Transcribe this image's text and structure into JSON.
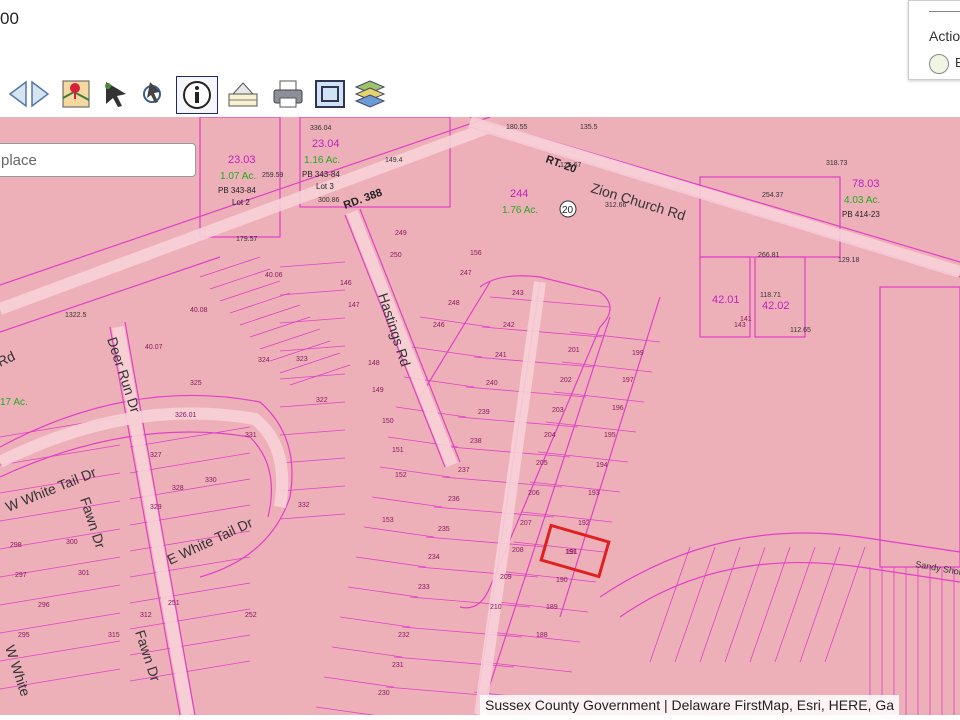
{
  "topbar": {
    "value": "00"
  },
  "actions_panel": {
    "title": "Actio",
    "item_label": "E"
  },
  "toolbar": {
    "tools": [
      "back-arrow",
      "forward-arrow",
      "map-pin",
      "select-arrow",
      "identify-pan",
      "info",
      "parcel",
      "print",
      "extent",
      "layers"
    ],
    "active_tool": "info"
  },
  "search": {
    "placeholder": "place"
  },
  "map": {
    "roads": {
      "rd388": "RD. 388",
      "hastings": "Hastings Rd",
      "deer_run": "Deer Run Dr",
      "zion_church": "Zion Church Rd",
      "rt20": "RT. 20",
      "rt20_shield": "20",
      "w_white_tail": "W White Tail Dr",
      "e_white_tail": "E White Tail Dr",
      "fawn_upper": "Fawn Dr",
      "fawn_lower": "Fawn Dr",
      "w_white_edge": "W White",
      "rd_edge": "Rd",
      "sandy_shore": "Sandy Shore"
    },
    "parcels": [
      {
        "id": "23.03",
        "acres": "1.07 Ac.",
        "pb": "PB 343-84",
        "lot": "Lot 2"
      },
      {
        "id": "23.04",
        "acres": "1.16 Ac.",
        "pb": "PB 343-84",
        "lot": "Lot 3"
      },
      {
        "id": "244",
        "acres": "1.76 Ac."
      },
      {
        "id": "78.03",
        "acres": "4.03 Ac.",
        "pb": "PB 414-23"
      },
      {
        "id": "42.01"
      },
      {
        "id": "42.02"
      }
    ],
    "edge_acres": "17 Ac.",
    "distances": [
      "336.04",
      "259.59",
      "300.86",
      "179.57",
      "1322.5",
      "180.55",
      "312.66",
      "254.37",
      "318.73",
      "266.81",
      "129.18",
      "118.71",
      "112.65",
      "149.4",
      "125.67",
      "135.5"
    ],
    "lot_numbers": [
      "243",
      "242",
      "241",
      "240",
      "239",
      "238",
      "237",
      "236",
      "235",
      "234",
      "233",
      "201",
      "202",
      "203",
      "204",
      "205",
      "206",
      "207",
      "208",
      "209",
      "210",
      "199",
      "197",
      "196",
      "195",
      "194",
      "193",
      "192",
      "191",
      "190",
      "189",
      "188",
      "322",
      "323",
      "324",
      "325",
      "326.01",
      "327",
      "328",
      "329",
      "330",
      "331",
      "332",
      "300",
      "301",
      "298",
      "297",
      "296",
      "295",
      "232",
      "231",
      "230",
      "143",
      "141",
      "40.06",
      "40.07",
      "40.08",
      "146",
      "147",
      "148",
      "149",
      "150",
      "151",
      "152",
      "153",
      "156",
      "247",
      "246",
      "248",
      "249",
      "250",
      "251",
      "252",
      "312",
      "315",
      "309",
      "305"
    ],
    "highlighted_parcel": "191"
  },
  "attribution": "Sussex County Government | Delaware FirstMap, Esri, HERE, Ga",
  "colors": {
    "map_fill": "#eeb0b8",
    "parcel_line": "#e040c8",
    "road_fill": "#f2c4cc",
    "highlight": "#e02020",
    "toolbar_border": "#1b2a6b"
  }
}
